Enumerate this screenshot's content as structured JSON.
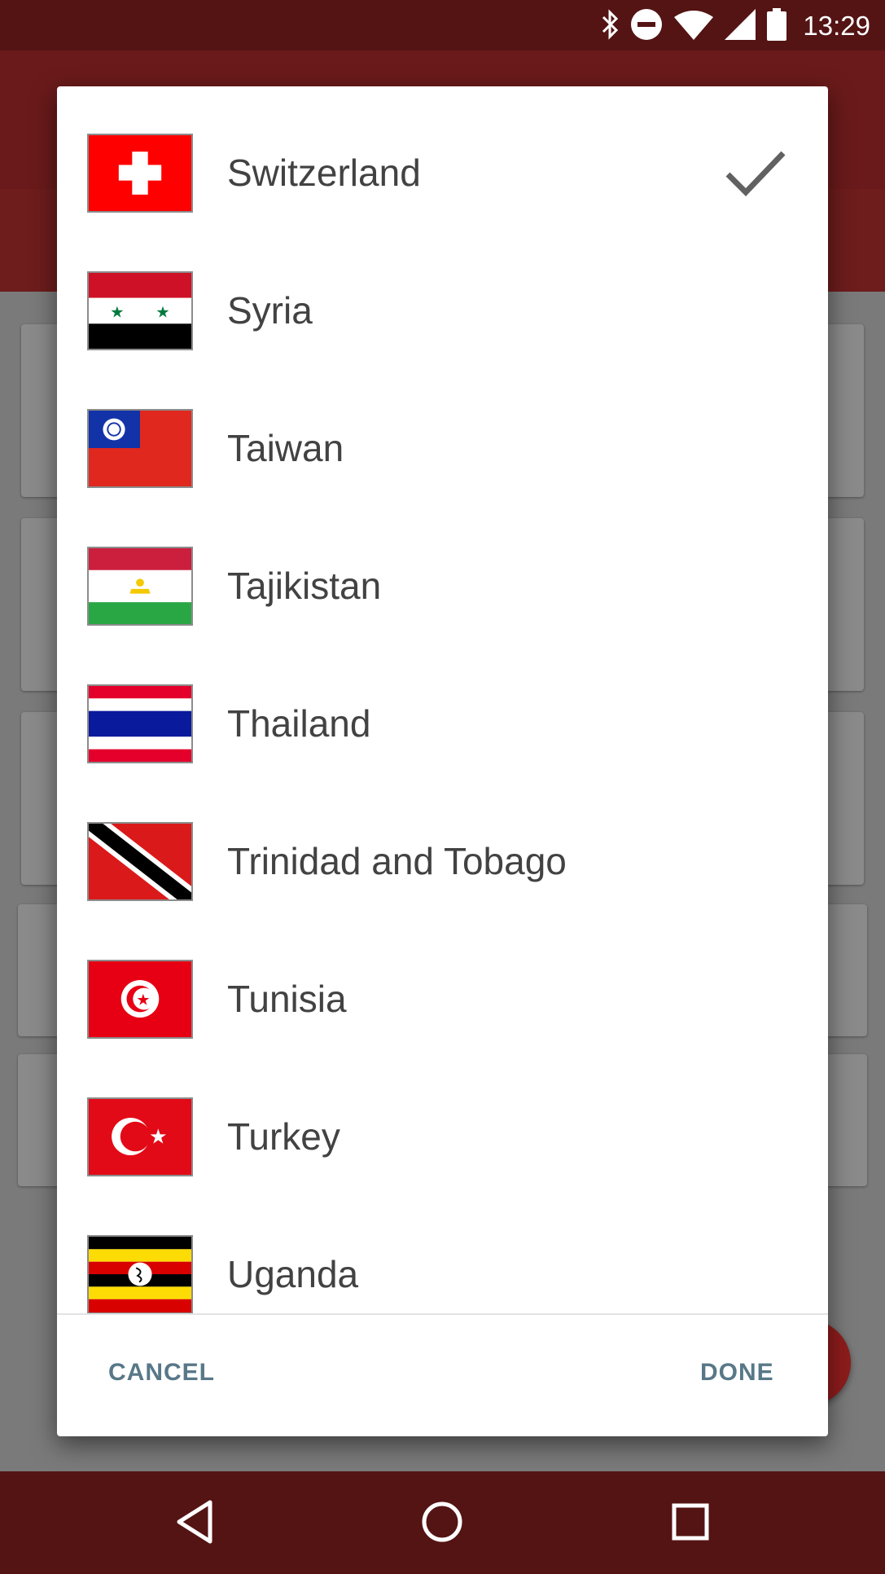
{
  "status_bar": {
    "time": "13:29",
    "icons": [
      "bluetooth-icon",
      "do-not-disturb-icon",
      "wifi-icon",
      "cell-signal-icon",
      "battery-icon"
    ]
  },
  "dialog": {
    "countries": [
      {
        "name": "Switzerland",
        "flag": "switzerland-flag",
        "selected": true
      },
      {
        "name": "Syria",
        "flag": "syria-flag",
        "selected": false
      },
      {
        "name": "Taiwan",
        "flag": "taiwan-flag",
        "selected": false
      },
      {
        "name": "Tajikistan",
        "flag": "tajikistan-flag",
        "selected": false
      },
      {
        "name": "Thailand",
        "flag": "thailand-flag",
        "selected": false
      },
      {
        "name": "Trinidad and Tobago",
        "flag": "trinidad-and-tobago-flag",
        "selected": false
      },
      {
        "name": "Tunisia",
        "flag": "tunisia-flag",
        "selected": false
      },
      {
        "name": "Turkey",
        "flag": "turkey-flag",
        "selected": false
      },
      {
        "name": "Uganda",
        "flag": "uganda-flag",
        "selected": false
      }
    ],
    "cancel_label": "CANCEL",
    "done_label": "DONE"
  },
  "nav_bar": {
    "icons": [
      "back-icon",
      "home-icon",
      "recents-icon"
    ]
  },
  "colors": {
    "status_bar": "#541414",
    "app_bar": "#6a1a1a",
    "scrim": "#7a7a7a",
    "dialog_action": "#587888",
    "list_text": "#424242"
  }
}
